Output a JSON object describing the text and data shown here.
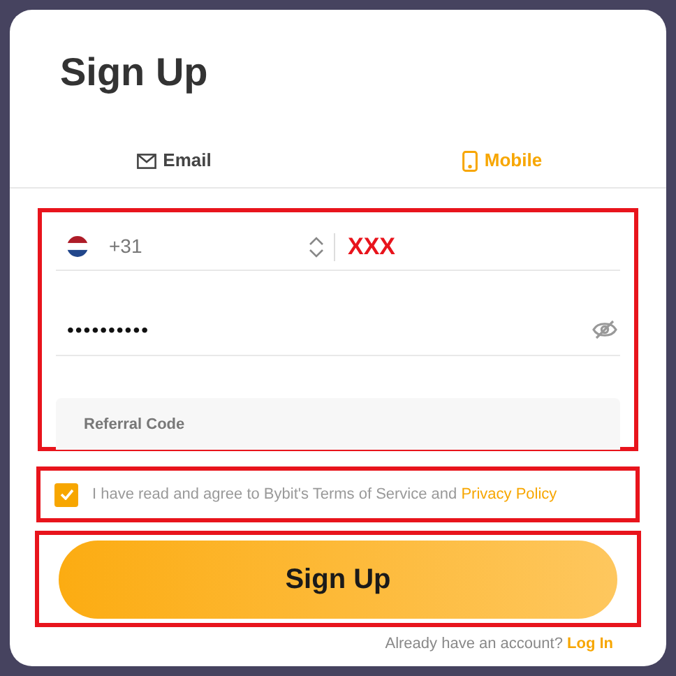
{
  "title": "Sign Up",
  "tabs": [
    {
      "kind": "email",
      "label": "Email",
      "selected": false
    },
    {
      "kind": "mobile",
      "label": "Mobile",
      "selected": true
    }
  ],
  "phone": {
    "country_code": "+31",
    "value": "XXX"
  },
  "password": {
    "value": "••••••••••"
  },
  "referral": {
    "placeholder": "Referral Code"
  },
  "agreement": {
    "checked": true,
    "text": "I have read and agree to Bybit's Terms of Service and",
    "link": "Privacy Policy"
  },
  "submit": "Sign Up",
  "footer": {
    "text": "Already have an account?",
    "link": "Log In"
  }
}
